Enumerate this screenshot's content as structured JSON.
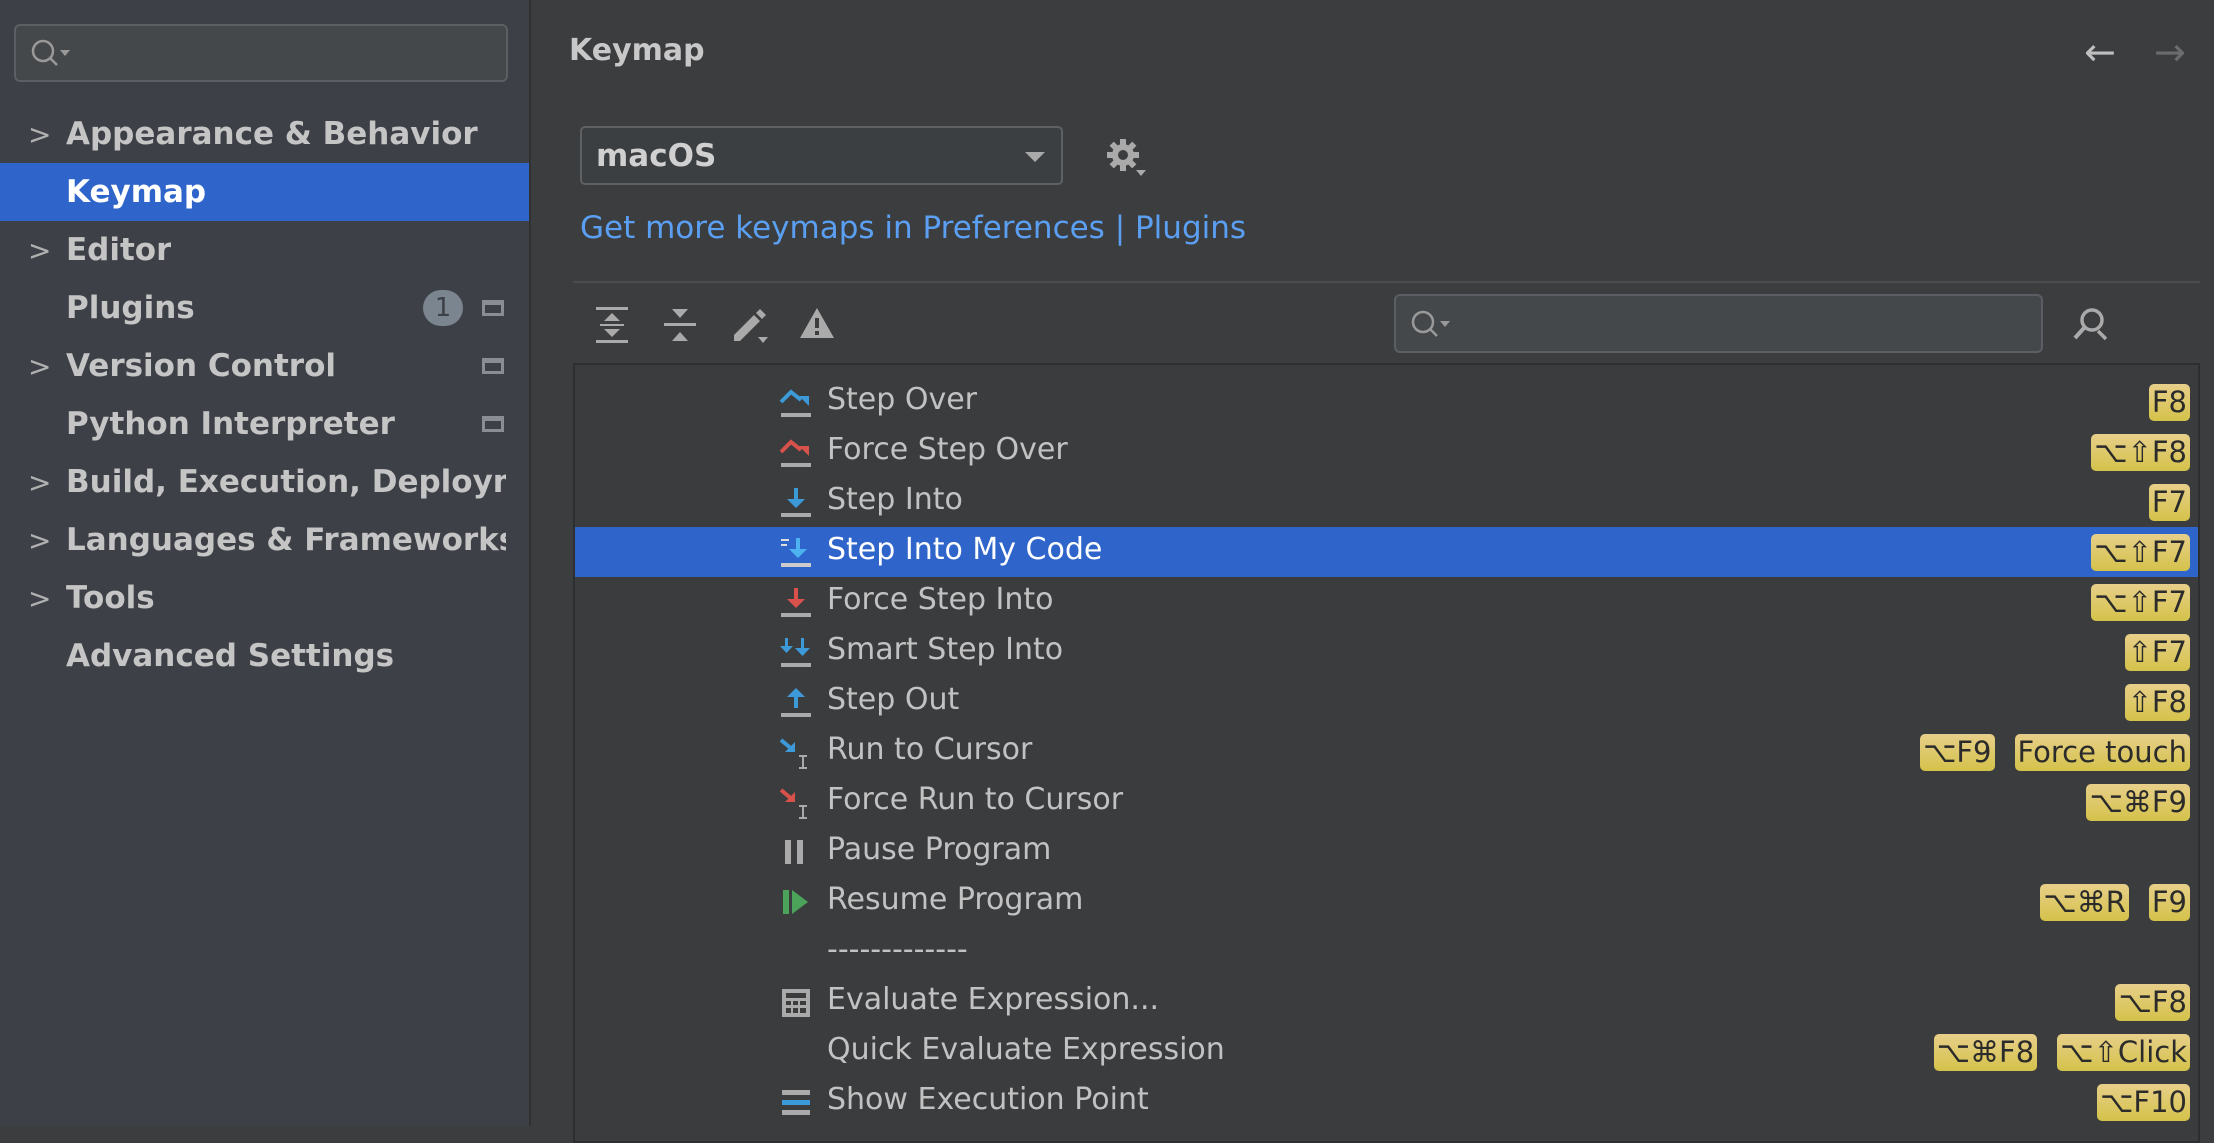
{
  "sidebar": {
    "search_placeholder": "",
    "items": [
      {
        "label": "Appearance & Behavior",
        "expandable": true
      },
      {
        "label": "Keymap",
        "selected": true
      },
      {
        "label": "Editor",
        "expandable": true
      },
      {
        "label": "Plugins",
        "badge": "1",
        "project_icon": true
      },
      {
        "label": "Version Control",
        "expandable": true,
        "project_icon": true
      },
      {
        "label": "Python Interpreter",
        "project_icon": true
      },
      {
        "label": "Build, Execution, Deployment",
        "expandable": true
      },
      {
        "label": "Languages & Frameworks",
        "expandable": true
      },
      {
        "label": "Tools",
        "expandable": true
      },
      {
        "label": "Advanced Settings"
      }
    ]
  },
  "header": {
    "title": "Keymap",
    "back_icon": "arrow-left-icon",
    "forward_icon": "arrow-right-icon"
  },
  "keymap_select": {
    "value": "macOS"
  },
  "link": "Get more keymaps in Preferences | Plugins",
  "toolbar": {
    "icons": [
      "expand-all-icon",
      "collapse-all-icon",
      "edit-icon",
      "warning-icon"
    ],
    "search_placeholder": "",
    "find_shortcut_icon": "find-by-shortcut-icon"
  },
  "colors": {
    "accent": "#2f65ca",
    "link": "#5b9ff2",
    "shortcut_badge": "#d9c75a",
    "sidebar_bg": "#3d4047",
    "main_bg": "#3c3d3f"
  },
  "actions": [
    {
      "label": "Step Over",
      "icon": "step-over",
      "keys": [
        "F8"
      ]
    },
    {
      "label": "Force Step Over",
      "icon": "force-step-over",
      "keys": [
        "⌥⇧F8"
      ]
    },
    {
      "label": "Step Into",
      "icon": "step-into",
      "keys": [
        "F7"
      ]
    },
    {
      "label": "Step Into My Code",
      "icon": "step-into-my-code",
      "keys": [
        "⌥⇧F7"
      ],
      "selected": true
    },
    {
      "label": "Force Step Into",
      "icon": "force-step-into",
      "keys": [
        "⌥⇧F7"
      ]
    },
    {
      "label": "Smart Step Into",
      "icon": "smart-step-into",
      "keys": [
        "⇧F7"
      ]
    },
    {
      "label": "Step Out",
      "icon": "step-out",
      "keys": [
        "⇧F8"
      ]
    },
    {
      "label": "Run to Cursor",
      "icon": "run-to-cursor",
      "keys": [
        "⌥F9",
        "Force touch"
      ]
    },
    {
      "label": "Force Run to Cursor",
      "icon": "force-run-to-cursor",
      "keys": [
        "⌥⌘F9"
      ]
    },
    {
      "label": "Pause Program",
      "icon": "pause",
      "keys": []
    },
    {
      "label": "Resume Program",
      "icon": "resume",
      "keys": [
        "⌥⌘R",
        "F9"
      ]
    },
    {
      "label": "-------------",
      "icon": "",
      "keys": []
    },
    {
      "label": "Evaluate Expression...",
      "icon": "calculator",
      "keys": [
        "⌥F8"
      ]
    },
    {
      "label": "Quick Evaluate Expression",
      "icon": "",
      "keys": [
        "⌥⌘F8",
        "⌥⇧Click"
      ]
    },
    {
      "label": "Show Execution Point",
      "icon": "show-execution-point",
      "keys": [
        "⌥F10"
      ]
    }
  ]
}
